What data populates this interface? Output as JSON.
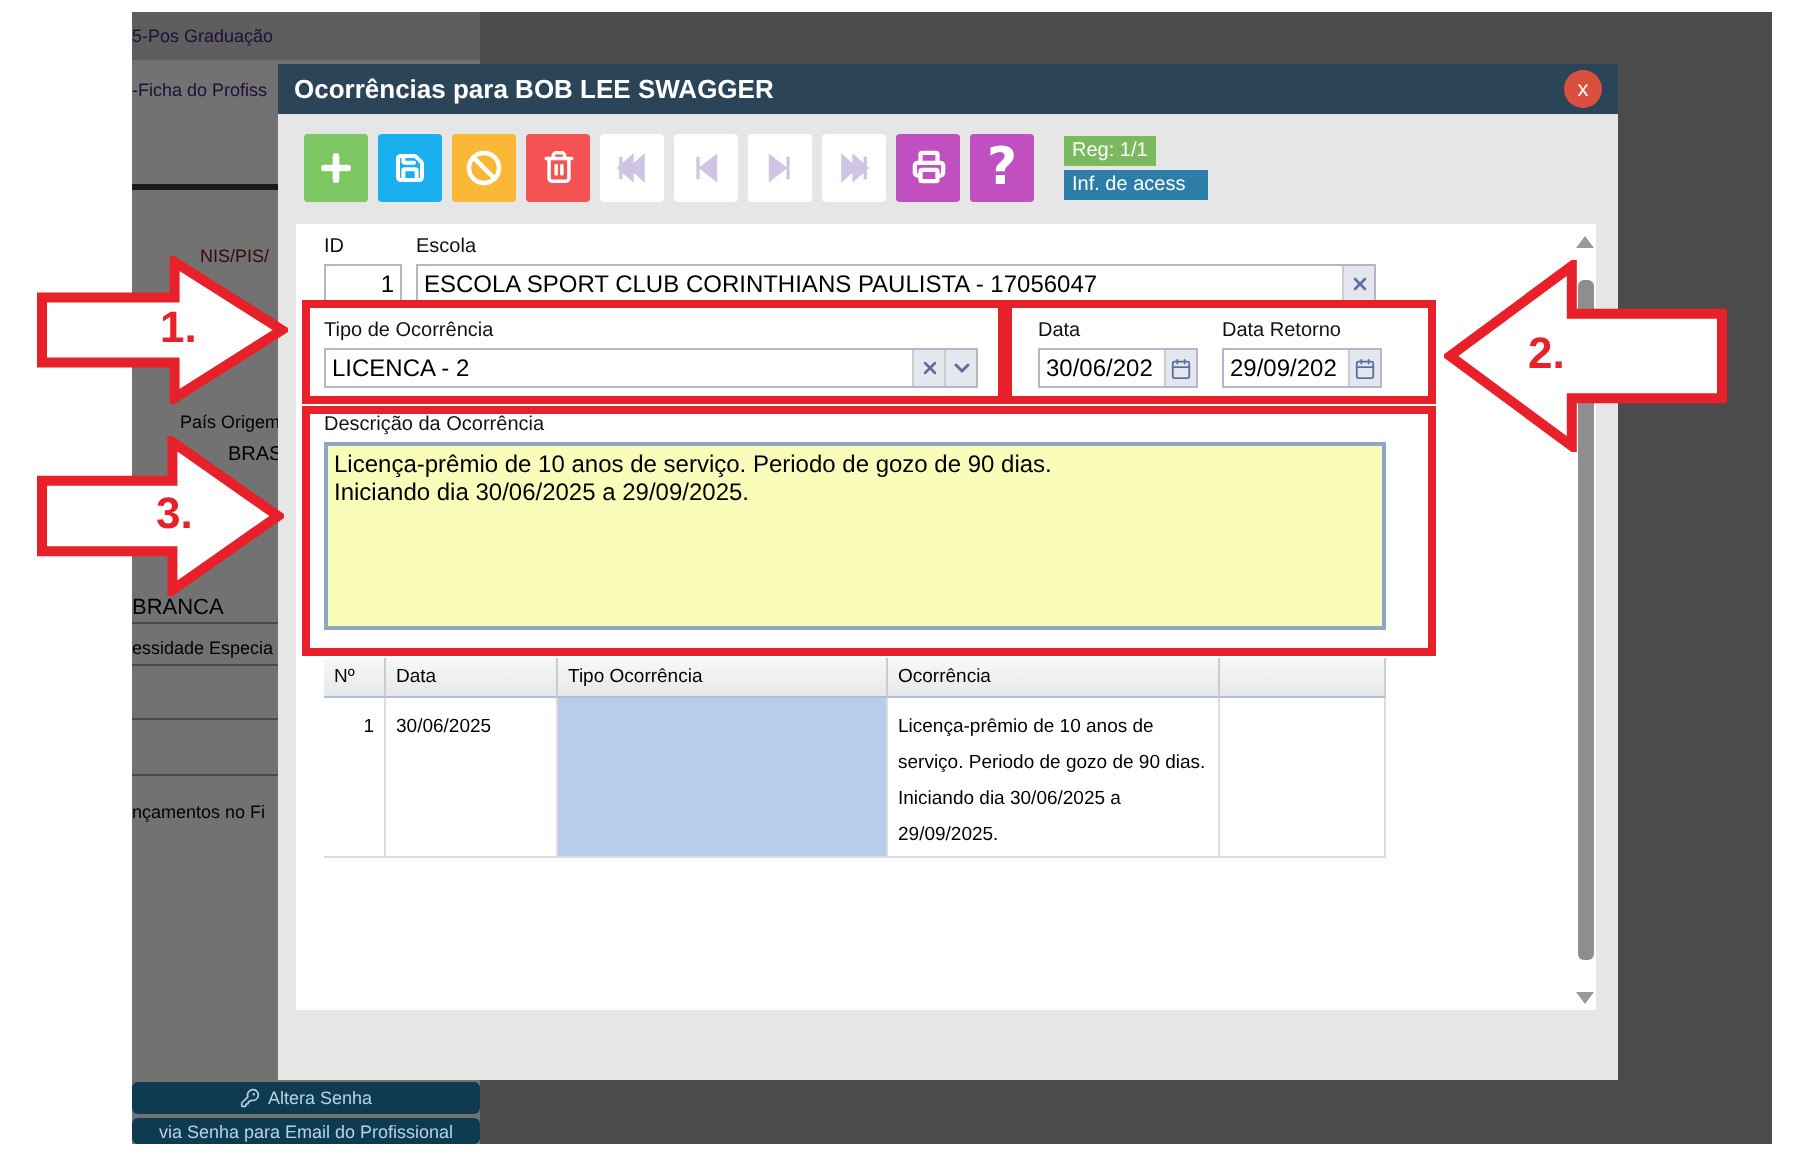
{
  "background_page": {
    "menu_items": [
      "5-Pos Graduação",
      "-Ficha do Profiss"
    ],
    "labels": [
      "NIS/PIS/",
      "País Origem"
    ],
    "country_value": "BRAS",
    "race_value": "BRANCA",
    "special_needs_label": "essidade Especia",
    "finance_label": "nçamentos no Fi",
    "buttons": [
      "Altera Senha",
      "via Senha para Email do Profissional"
    ]
  },
  "dialog": {
    "title": "Ocorrências para BOB LEE SWAGGER",
    "close": "x"
  },
  "toolbar": [
    {
      "kind": "add",
      "disabled": false
    },
    {
      "kind": "save",
      "disabled": false
    },
    {
      "kind": "cancel",
      "disabled": false
    },
    {
      "kind": "delete",
      "disabled": false
    },
    {
      "kind": "first",
      "disabled": true
    },
    {
      "kind": "prev",
      "disabled": true
    },
    {
      "kind": "next",
      "disabled": true
    },
    {
      "kind": "last",
      "disabled": true
    },
    {
      "kind": "print",
      "disabled": false
    },
    {
      "kind": "help",
      "label": "?",
      "disabled": false
    }
  ],
  "record_badge": "Reg: 1/1",
  "access_badge": "Inf. de acess",
  "form": {
    "id": {
      "label": "ID",
      "value": "1"
    },
    "school": {
      "label": "Escola",
      "value": "ESCOLA SPORT CLUB CORINTHIANS PAULISTA - 17056047"
    },
    "type": {
      "label": "Tipo de Ocorrência",
      "value": "LICENCA - 2"
    },
    "date": {
      "label": "Data",
      "value": "30/06/202"
    },
    "return_date": {
      "label": "Data Retorno",
      "value": "29/09/202"
    },
    "description": {
      "label": "Descrição da Ocorrência",
      "value": "Licença-prêmio de 10 anos de serviço. Periodo de gozo de 90 dias.\nIniciando dia 30/06/2025 a 29/09/2025."
    }
  },
  "table": {
    "columns": [
      "Nº",
      "Data",
      "Tipo Ocorrência",
      "Ocorrência"
    ],
    "rows": [
      {
        "number": "1",
        "date": "30/06/2025",
        "occurrence": "Licença-prêmio de 10 anos de serviço. Periodo de gozo de 90 dias. Iniciando dia 30/06/2025 a 29/09/2025.",
        "selected": true
      }
    ]
  },
  "annotations": [
    {
      "label": "1.",
      "kind": "right"
    },
    {
      "label": "2.",
      "kind": "left"
    },
    {
      "label": "3.",
      "kind": "right"
    }
  ]
}
